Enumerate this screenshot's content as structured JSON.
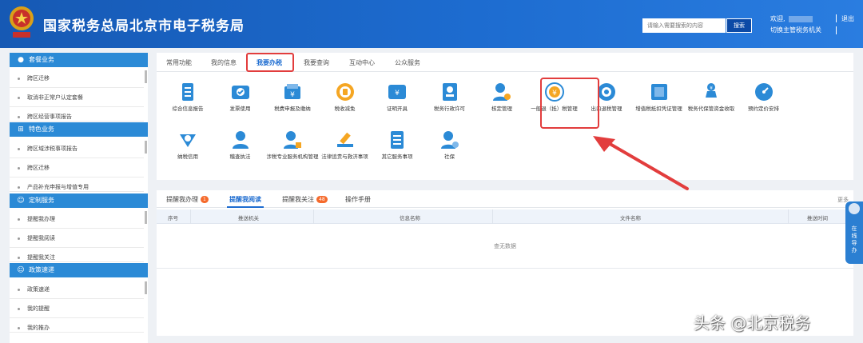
{
  "header": {
    "site_title": "国家税务总局北京市电子税务局",
    "search_placeholder": "请输入需要搜索的内容",
    "search_button": "搜索",
    "welcome": "欢迎,",
    "switch_link": "切换主管税务机关",
    "logout": "退出"
  },
  "sidebar": {
    "sections": [
      {
        "title": "套餐业务",
        "icon": "package-icon",
        "items": [
          "跨区迁移",
          "取消非正常户认定套餐",
          "跨区经营事项报告"
        ]
      },
      {
        "title": "特色业务",
        "icon": "grid-icon",
        "items": [
          "跨区域涉税事项报告",
          "跨区迁移",
          "产品补充申报与增值专用"
        ]
      },
      {
        "title": "定制服务",
        "icon": "user-icon",
        "items": [
          "提醒我办理",
          "提醒我阅读",
          "提醒我关注"
        ]
      },
      {
        "title": "政策速递",
        "icon": "user-icon",
        "items": [
          "政策速递",
          "我的提醒",
          "我的推办"
        ]
      }
    ]
  },
  "main": {
    "tabs": [
      {
        "label": "常用功能",
        "active": false
      },
      {
        "label": "我的信息",
        "active": false
      },
      {
        "label": "我要办税",
        "active": true
      },
      {
        "label": "我要查询",
        "active": false
      },
      {
        "label": "互动中心",
        "active": false
      },
      {
        "label": "公众服务",
        "active": false
      }
    ],
    "services_row1": [
      {
        "label": "综合信息报告",
        "icon": "document-icon",
        "color": "#2b8ad6"
      },
      {
        "label": "发票使用",
        "icon": "invoice-icon",
        "color": "#2b8ad6"
      },
      {
        "label": "税费申报及缴纳",
        "icon": "tax-payment-icon",
        "color": "#2b8ad6"
      },
      {
        "label": "税收减免",
        "icon": "tax-relief-icon",
        "color": "#f5a623"
      },
      {
        "label": "证明开具",
        "icon": "certificate-icon",
        "color": "#2b8ad6"
      },
      {
        "label": "税务行政许可",
        "icon": "license-icon",
        "color": "#2b8ad6"
      },
      {
        "label": "核定管理",
        "icon": "verify-icon",
        "color": "#2b8ad6"
      },
      {
        "label": "一般退（抵）税管理",
        "icon": "refund-icon",
        "color": "#f5a623"
      },
      {
        "label": "出口退税管理",
        "icon": "export-refund-icon",
        "color": "#2b8ad6"
      },
      {
        "label": "增值税抵扣凭证管理",
        "icon": "vat-deduct-icon",
        "color": "#2b8ad6"
      },
      {
        "label": "税务代保管资金收取",
        "icon": "fund-icon",
        "color": "#2b8ad6"
      },
      {
        "label": "预约定价安排",
        "icon": "pricing-icon",
        "color": "#2b8ad6"
      }
    ],
    "services_row2": [
      {
        "label": "纳税信用",
        "icon": "credit-icon",
        "color": "#2b8ad6"
      },
      {
        "label": "稽查执法",
        "icon": "inspection-icon",
        "color": "#2b8ad6"
      },
      {
        "label": "涉税专业服务机构管理",
        "icon": "agency-icon",
        "color": "#2b8ad6"
      },
      {
        "label": "法律追责与救济事项",
        "icon": "legal-icon",
        "color": "#2b8ad6"
      },
      {
        "label": "其它服务事项",
        "icon": "other-service-icon",
        "color": "#2b8ad6"
      },
      {
        "label": "社保",
        "icon": "social-security-icon",
        "color": "#2b8ad6"
      }
    ]
  },
  "lower": {
    "tabs": [
      {
        "label": "提醒我办理",
        "badge": "1"
      },
      {
        "label": "提醒我阅读",
        "badge": ""
      },
      {
        "label": "提醒我关注",
        "badge": "48"
      },
      {
        "label": "操作手册",
        "badge": ""
      }
    ],
    "more": "更多",
    "columns": [
      "序号",
      "推送机关",
      "信息名称",
      "文件名称",
      "推送时间"
    ],
    "empty_text": "查无数据"
  },
  "float_nav": {
    "label": "在线导办"
  },
  "watermark": "头条 @北京税务",
  "colors": {
    "brand": "#1d6cd0",
    "highlight": "#e23d3d",
    "badge": "#f56a2c",
    "section": "#2b8ad6"
  }
}
